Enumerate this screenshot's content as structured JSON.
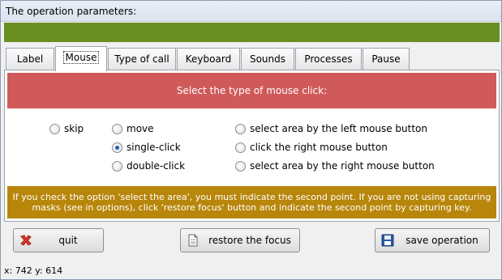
{
  "window": {
    "title": "The operation parameters:"
  },
  "colors": {
    "green_bar": "#6b8e23",
    "red_bar": "#d0595a",
    "orange_bar": "#b8860b"
  },
  "tabs": [
    {
      "label": "Label",
      "active": false
    },
    {
      "label": "Mouse",
      "active": true
    },
    {
      "label": "Type of call",
      "active": false
    },
    {
      "label": "Keyboard",
      "active": false
    },
    {
      "label": "Sounds",
      "active": false
    },
    {
      "label": "Processes",
      "active": false
    },
    {
      "label": "Pause",
      "active": false
    }
  ],
  "mouse_panel": {
    "header": "Select the type of mouse click:",
    "options": {
      "skip": "skip",
      "move": "move",
      "single_click": "single-click",
      "double_click": "double-click",
      "select_left": "select area by the left mouse button",
      "click_right": "click the right mouse button",
      "select_right": "select area by the right mouse button"
    },
    "selected": "single-click",
    "hint": "If you check the option 'select the area', you must indicate the second point. If you are not using capturing masks (see in options), click 'restore focus' button and indicate the second point by capturing key."
  },
  "buttons": {
    "quit": {
      "label": "quit",
      "icon": "red-x-icon"
    },
    "restore": {
      "label": "restore the focus",
      "icon": "document-icon"
    },
    "save": {
      "label": "save operation",
      "icon": "floppy-disk-icon"
    }
  },
  "status": {
    "coords": "x: 742  y: 614"
  }
}
